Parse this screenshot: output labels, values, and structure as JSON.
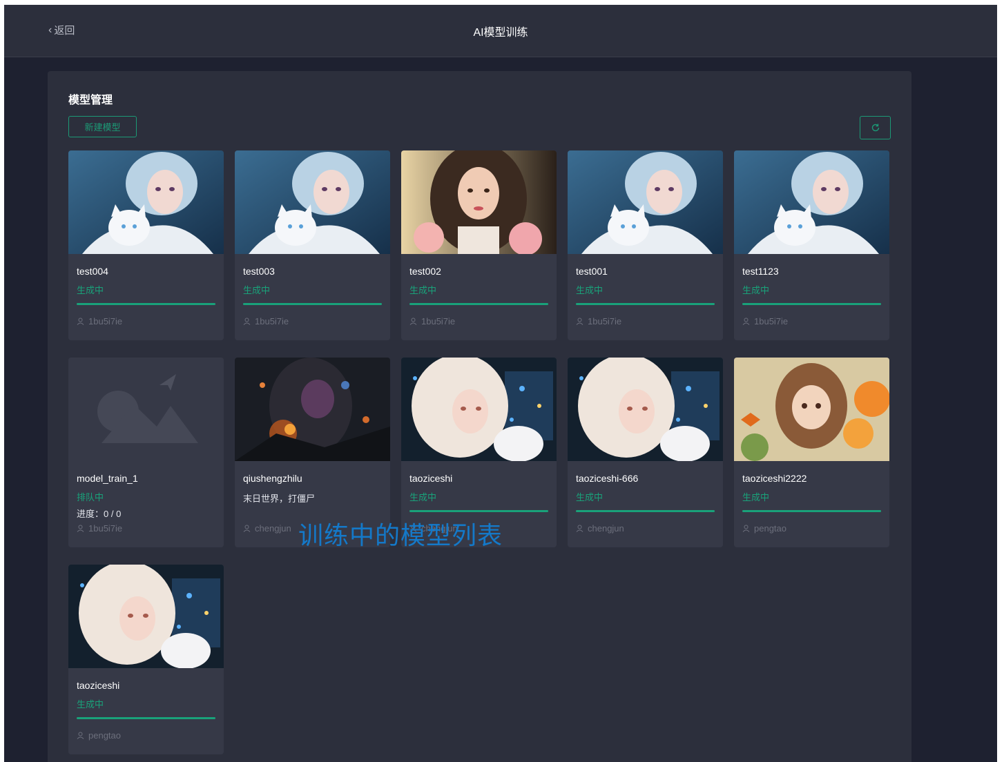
{
  "header": {
    "back_label": "返回",
    "title": "AI模型训练"
  },
  "section": {
    "title": "模型管理",
    "new_button": "新建模型"
  },
  "cards": [
    {
      "name": "test004",
      "status": "生成中",
      "progress": 1.0,
      "user": "1bu5i7ie",
      "image": "girl-cat-blue"
    },
    {
      "name": "test003",
      "status": "生成中",
      "progress": 1.0,
      "user": "1bu5i7ie",
      "image": "girl-cat-blue"
    },
    {
      "name": "test002",
      "status": "生成中",
      "progress": 1.0,
      "user": "1bu5i7ie",
      "image": "girl-roses"
    },
    {
      "name": "test001",
      "status": "生成中",
      "progress": 1.0,
      "user": "1bu5i7ie",
      "image": "girl-cat-blue"
    },
    {
      "name": "test1123",
      "status": "生成中",
      "progress": 1.0,
      "user": "1bu5i7ie",
      "image": "girl-cat-blue"
    },
    {
      "name": "model_train_1",
      "status": "排队中",
      "progress_text": "进度：0 / 0",
      "user": "1bu5i7ie",
      "image": "placeholder"
    },
    {
      "name": "qiushengzhilu",
      "description": "末日世界，打僵尸",
      "user": "chengjun",
      "image": "dark-warrior"
    },
    {
      "name": "taoziceshi",
      "status": "生成中",
      "progress": 1.0,
      "user": "chengjun",
      "image": "white-hair-girl"
    },
    {
      "name": "taoziceshi-666",
      "status": "生成中",
      "progress": 1.0,
      "user": "chengjun",
      "image": "white-hair-girl"
    },
    {
      "name": "taoziceshi2222",
      "status": "生成中",
      "progress": 1.0,
      "user": "pengtao",
      "image": "girl-flowers"
    },
    {
      "name": "taoziceshi",
      "status": "生成中",
      "progress": 1.0,
      "user": "pengtao",
      "image": "white-hair-girl"
    }
  ],
  "overlay_caption": "训练中的模型列表",
  "colors": {
    "accent": "#19a27a",
    "caption": "#1479c9",
    "background": "#1e2130",
    "panel": "#2c2f3c",
    "card": "#363947"
  },
  "icons": {
    "back": "chevron-left-icon",
    "refresh": "refresh-icon",
    "user": "user-icon"
  }
}
